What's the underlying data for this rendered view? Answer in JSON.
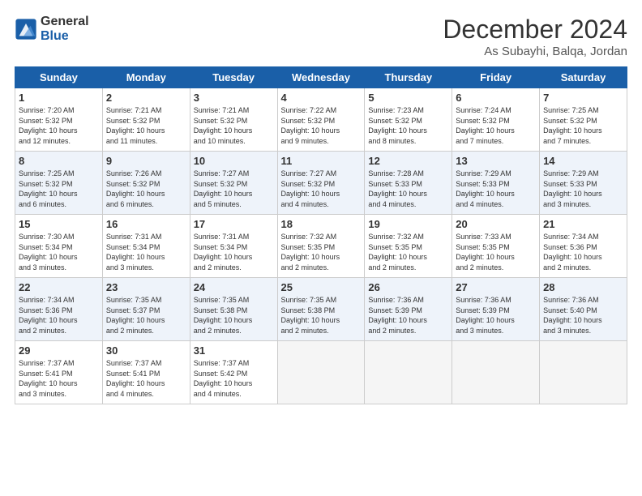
{
  "header": {
    "logo_line1": "General",
    "logo_line2": "Blue",
    "month": "December 2024",
    "location": "As Subayhi, Balqa, Jordan"
  },
  "weekdays": [
    "Sunday",
    "Monday",
    "Tuesday",
    "Wednesday",
    "Thursday",
    "Friday",
    "Saturday"
  ],
  "weeks": [
    [
      {
        "day": "1",
        "lines": [
          "Sunrise: 7:20 AM",
          "Sunset: 5:32 PM",
          "Daylight: 10 hours",
          "and 12 minutes."
        ]
      },
      {
        "day": "2",
        "lines": [
          "Sunrise: 7:21 AM",
          "Sunset: 5:32 PM",
          "Daylight: 10 hours",
          "and 11 minutes."
        ]
      },
      {
        "day": "3",
        "lines": [
          "Sunrise: 7:21 AM",
          "Sunset: 5:32 PM",
          "Daylight: 10 hours",
          "and 10 minutes."
        ]
      },
      {
        "day": "4",
        "lines": [
          "Sunrise: 7:22 AM",
          "Sunset: 5:32 PM",
          "Daylight: 10 hours",
          "and 9 minutes."
        ]
      },
      {
        "day": "5",
        "lines": [
          "Sunrise: 7:23 AM",
          "Sunset: 5:32 PM",
          "Daylight: 10 hours",
          "and 8 minutes."
        ]
      },
      {
        "day": "6",
        "lines": [
          "Sunrise: 7:24 AM",
          "Sunset: 5:32 PM",
          "Daylight: 10 hours",
          "and 7 minutes."
        ]
      },
      {
        "day": "7",
        "lines": [
          "Sunrise: 7:25 AM",
          "Sunset: 5:32 PM",
          "Daylight: 10 hours",
          "and 7 minutes."
        ]
      }
    ],
    [
      {
        "day": "8",
        "lines": [
          "Sunrise: 7:25 AM",
          "Sunset: 5:32 PM",
          "Daylight: 10 hours",
          "and 6 minutes."
        ]
      },
      {
        "day": "9",
        "lines": [
          "Sunrise: 7:26 AM",
          "Sunset: 5:32 PM",
          "Daylight: 10 hours",
          "and 6 minutes."
        ]
      },
      {
        "day": "10",
        "lines": [
          "Sunrise: 7:27 AM",
          "Sunset: 5:32 PM",
          "Daylight: 10 hours",
          "and 5 minutes."
        ]
      },
      {
        "day": "11",
        "lines": [
          "Sunrise: 7:27 AM",
          "Sunset: 5:32 PM",
          "Daylight: 10 hours",
          "and 4 minutes."
        ]
      },
      {
        "day": "12",
        "lines": [
          "Sunrise: 7:28 AM",
          "Sunset: 5:33 PM",
          "Daylight: 10 hours",
          "and 4 minutes."
        ]
      },
      {
        "day": "13",
        "lines": [
          "Sunrise: 7:29 AM",
          "Sunset: 5:33 PM",
          "Daylight: 10 hours",
          "and 4 minutes."
        ]
      },
      {
        "day": "14",
        "lines": [
          "Sunrise: 7:29 AM",
          "Sunset: 5:33 PM",
          "Daylight: 10 hours",
          "and 3 minutes."
        ]
      }
    ],
    [
      {
        "day": "15",
        "lines": [
          "Sunrise: 7:30 AM",
          "Sunset: 5:34 PM",
          "Daylight: 10 hours",
          "and 3 minutes."
        ]
      },
      {
        "day": "16",
        "lines": [
          "Sunrise: 7:31 AM",
          "Sunset: 5:34 PM",
          "Daylight: 10 hours",
          "and 3 minutes."
        ]
      },
      {
        "day": "17",
        "lines": [
          "Sunrise: 7:31 AM",
          "Sunset: 5:34 PM",
          "Daylight: 10 hours",
          "and 2 minutes."
        ]
      },
      {
        "day": "18",
        "lines": [
          "Sunrise: 7:32 AM",
          "Sunset: 5:35 PM",
          "Daylight: 10 hours",
          "and 2 minutes."
        ]
      },
      {
        "day": "19",
        "lines": [
          "Sunrise: 7:32 AM",
          "Sunset: 5:35 PM",
          "Daylight: 10 hours",
          "and 2 minutes."
        ]
      },
      {
        "day": "20",
        "lines": [
          "Sunrise: 7:33 AM",
          "Sunset: 5:35 PM",
          "Daylight: 10 hours",
          "and 2 minutes."
        ]
      },
      {
        "day": "21",
        "lines": [
          "Sunrise: 7:34 AM",
          "Sunset: 5:36 PM",
          "Daylight: 10 hours",
          "and 2 minutes."
        ]
      }
    ],
    [
      {
        "day": "22",
        "lines": [
          "Sunrise: 7:34 AM",
          "Sunset: 5:36 PM",
          "Daylight: 10 hours",
          "and 2 minutes."
        ]
      },
      {
        "day": "23",
        "lines": [
          "Sunrise: 7:35 AM",
          "Sunset: 5:37 PM",
          "Daylight: 10 hours",
          "and 2 minutes."
        ]
      },
      {
        "day": "24",
        "lines": [
          "Sunrise: 7:35 AM",
          "Sunset: 5:38 PM",
          "Daylight: 10 hours",
          "and 2 minutes."
        ]
      },
      {
        "day": "25",
        "lines": [
          "Sunrise: 7:35 AM",
          "Sunset: 5:38 PM",
          "Daylight: 10 hours",
          "and 2 minutes."
        ]
      },
      {
        "day": "26",
        "lines": [
          "Sunrise: 7:36 AM",
          "Sunset: 5:39 PM",
          "Daylight: 10 hours",
          "and 2 minutes."
        ]
      },
      {
        "day": "27",
        "lines": [
          "Sunrise: 7:36 AM",
          "Sunset: 5:39 PM",
          "Daylight: 10 hours",
          "and 3 minutes."
        ]
      },
      {
        "day": "28",
        "lines": [
          "Sunrise: 7:36 AM",
          "Sunset: 5:40 PM",
          "Daylight: 10 hours",
          "and 3 minutes."
        ]
      }
    ],
    [
      {
        "day": "29",
        "lines": [
          "Sunrise: 7:37 AM",
          "Sunset: 5:41 PM",
          "Daylight: 10 hours",
          "and 3 minutes."
        ]
      },
      {
        "day": "30",
        "lines": [
          "Sunrise: 7:37 AM",
          "Sunset: 5:41 PM",
          "Daylight: 10 hours",
          "and 4 minutes."
        ]
      },
      {
        "day": "31",
        "lines": [
          "Sunrise: 7:37 AM",
          "Sunset: 5:42 PM",
          "Daylight: 10 hours",
          "and 4 minutes."
        ]
      },
      null,
      null,
      null,
      null
    ]
  ]
}
